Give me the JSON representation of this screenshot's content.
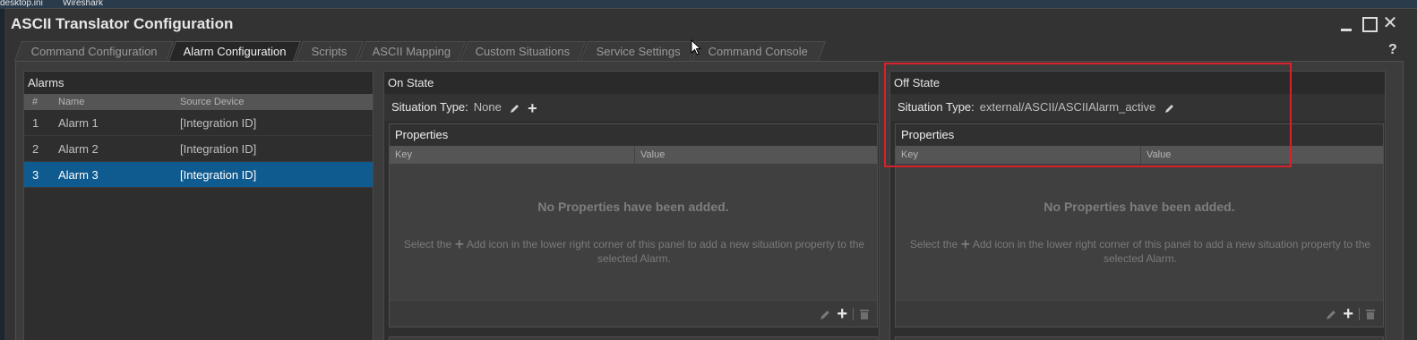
{
  "desktop": {
    "items": [
      "desktop.ini",
      "Wireshark"
    ]
  },
  "window": {
    "title": "ASCII Translator Configuration",
    "help": "?"
  },
  "tabs": [
    {
      "label": "Command Configuration"
    },
    {
      "label": "Alarm Configuration"
    },
    {
      "label": "Scripts"
    },
    {
      "label": "ASCII Mapping"
    },
    {
      "label": "Custom Situations"
    },
    {
      "label": "Service Settings"
    },
    {
      "label": "Command Console"
    }
  ],
  "active_tab": "Alarm Configuration",
  "alarms": {
    "title": "Alarms",
    "columns": {
      "num": "#",
      "name": "Name",
      "source": "Source Device"
    },
    "rows": [
      {
        "num": "1",
        "name": "Alarm 1",
        "source": "[Integration ID]"
      },
      {
        "num": "2",
        "name": "Alarm 2",
        "source": "[Integration ID]"
      },
      {
        "num": "3",
        "name": "Alarm 3",
        "source": "[Integration ID]"
      }
    ],
    "selected": "3"
  },
  "on_state": {
    "title": "On State",
    "situation_label": "Situation Type:",
    "situation_value": "None",
    "properties": {
      "title": "Properties",
      "key_col": "Key",
      "value_col": "Value",
      "empty_title": "No Properties have been added.",
      "help_before": "Select the",
      "help_after": "Add icon in the lower right corner of this panel to add a new situation property to the selected Alarm."
    }
  },
  "off_state": {
    "title": "Off State",
    "situation_label": "Situation Type:",
    "situation_value": "external/ASCII/ASCIIAlarm_active",
    "properties": {
      "title": "Properties",
      "key_col": "Key",
      "value_col": "Value",
      "empty_title": "No Properties have been added.",
      "help_before": "Select the",
      "help_after": "Add icon in the lower right corner of this panel to add a new situation property to the selected Alarm."
    }
  },
  "colors": {
    "selection": "#0f5a8e",
    "highlight": "#d8212b"
  }
}
